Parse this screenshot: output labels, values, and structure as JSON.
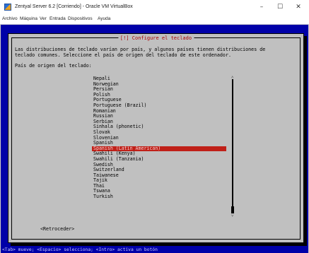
{
  "window": {
    "title": "Zentyal Server 6.2  [Corriendo] - Oracle VM VirtualBox",
    "minimize": "–",
    "maximize": "☐",
    "close": "✕"
  },
  "menu": [
    "Archivo",
    "Máquina",
    "Ver",
    "Entrada",
    "Dispositivos",
    "Ayuda"
  ],
  "dialog": {
    "title": "[!] Configure el teclado",
    "description_line1": "Las distribuciones de teclado varían por país, y algunos países tienen distribuciones de",
    "description_line2": "teclado comunes. Seleccione el país de origen del teclado de este ordenador.",
    "prompt": "País de origen del teclado:",
    "items": [
      "Nepali",
      "Norwegian",
      "Persian",
      "Polish",
      "Portuguese",
      "Portuguese (Brazil)",
      "Romanian",
      "Russian",
      "Serbian",
      "Sinhala (phonetic)",
      "Slovak",
      "Slovenian",
      "Spanish",
      "Spanish (Latin American)",
      "Swahili (Kenya)",
      "Swahili (Tanzania)",
      "Swedish",
      "Switzerland",
      "Taiwanese",
      "Tajik",
      "Thai",
      "Tswana",
      "Turkish"
    ],
    "selected_index": 13,
    "back_button": "<Retroceder>"
  },
  "statusbar": "<Tab> mueve; <Espacio> selecciona; <Intro> activa un botón",
  "colors": {
    "screen_bg": "#0000a8",
    "dialog_bg": "#c0c0c0",
    "selected_bg": "#c02018",
    "title_fg": "#aa0000"
  }
}
